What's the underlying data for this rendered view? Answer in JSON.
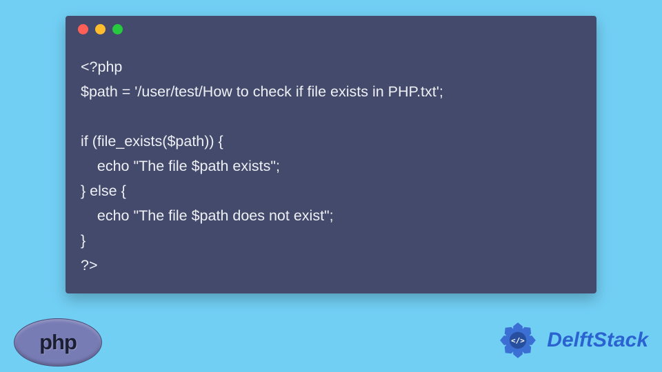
{
  "code": {
    "line1": "<?php",
    "line2": "$path = '/user/test/How to check if file exists in PHP.txt';",
    "line3": "",
    "line4": "if (file_exists($path)) {",
    "line5": "    echo \"The file $path exists\";",
    "line6": "} else {",
    "line7": "    echo \"The file $path does not exist\";",
    "line8": "}",
    "line9": "?>"
  },
  "logos": {
    "php": "php",
    "delftstack": "DelftStack"
  },
  "colors": {
    "background": "#72cff4",
    "window": "#434A6B",
    "text": "#eef0f5"
  }
}
